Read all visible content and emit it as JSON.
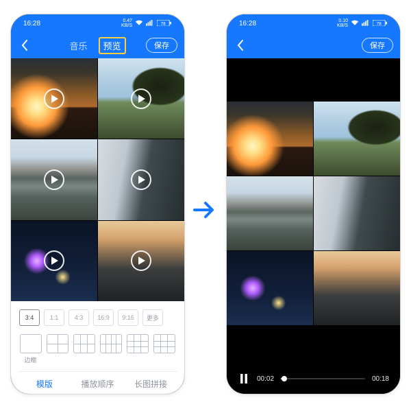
{
  "status": {
    "time": "16:28",
    "net_speed_top": "0.10",
    "net_speed_unit": "KB/S",
    "battery": "78"
  },
  "status_left": {
    "net_speed_top": "0.47"
  },
  "nav": {
    "back": "‹",
    "tab_music": "音乐",
    "tab_preview": "预览",
    "save": "保存"
  },
  "ratios": [
    "3:4",
    "1:1",
    "4:3",
    "16:9",
    "9:16",
    "更多"
  ],
  "layouts": {
    "border_label": "边框"
  },
  "bottom_tabs": {
    "template": "模版",
    "order": "播放顺序",
    "stitch": "长图拼接"
  },
  "playback": {
    "current": "00:02",
    "total": "00:18"
  }
}
